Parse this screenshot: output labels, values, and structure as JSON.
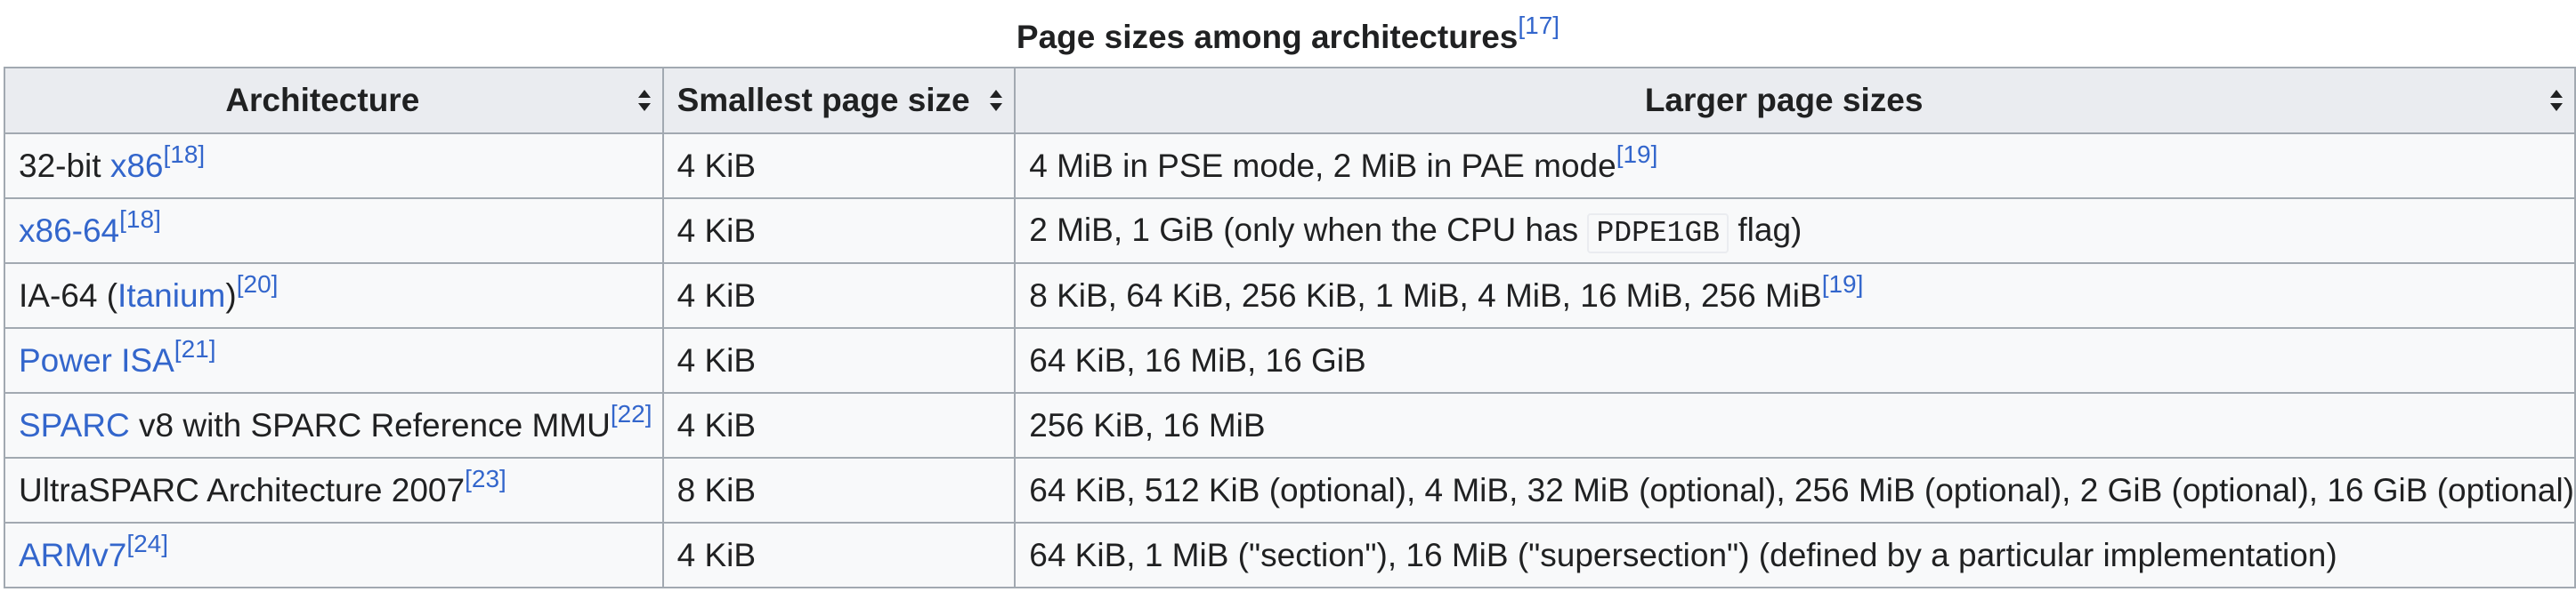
{
  "caption": {
    "text": "Page sizes among architectures",
    "ref": "[17]"
  },
  "headers": [
    {
      "label": "Architecture",
      "sort_icon": "sort-icon"
    },
    {
      "label": "Smallest page size",
      "sort_icon": "sort-icon"
    },
    {
      "label": "Larger page sizes",
      "sort_icon": "sort-icon"
    }
  ],
  "rows": [
    {
      "arch_pre": "32-bit ",
      "arch_link": "x86",
      "arch_post": "",
      "arch_ref": "[18]",
      "smallest": "4 KiB",
      "larger_pre": "4 MiB in PSE mode, 2 MiB in PAE mode",
      "larger_code": "",
      "larger_post": "",
      "larger_ref": "[19]"
    },
    {
      "arch_pre": "",
      "arch_link": "x86-64",
      "arch_post": "",
      "arch_ref": "[18]",
      "smallest": "4 KiB",
      "larger_pre": "2 MiB, 1 GiB (only when the CPU has ",
      "larger_code": "PDPE1GB",
      "larger_post": " flag)",
      "larger_ref": ""
    },
    {
      "arch_pre": "IA-64 (",
      "arch_link": "Itanium",
      "arch_post": ")",
      "arch_ref": "[20]",
      "smallest": "4 KiB",
      "larger_pre": "8 KiB, 64 KiB, 256 KiB, 1 MiB, 4 MiB, 16 MiB, 256 MiB",
      "larger_code": "",
      "larger_post": "",
      "larger_ref": "[19]"
    },
    {
      "arch_pre": "",
      "arch_link": "Power ISA",
      "arch_post": "",
      "arch_ref": "[21]",
      "smallest": "4 KiB",
      "larger_pre": "64 KiB, 16 MiB, 16 GiB",
      "larger_code": "",
      "larger_post": "",
      "larger_ref": ""
    },
    {
      "arch_pre": "",
      "arch_link": "SPARC",
      "arch_post": " v8 with SPARC Reference MMU",
      "arch_ref": "[22]",
      "smallest": "4 KiB",
      "larger_pre": "256 KiB, 16 MiB",
      "larger_code": "",
      "larger_post": "",
      "larger_ref": ""
    },
    {
      "arch_pre": "UltraSPARC Architecture 2007",
      "arch_link": "",
      "arch_post": "",
      "arch_ref": "[23]",
      "smallest": "8 KiB",
      "larger_pre": "64 KiB, 512 KiB (optional), 4 MiB, 32 MiB (optional), 256 MiB (optional), 2 GiB (optional), 16 GiB (optional)",
      "larger_code": "",
      "larger_post": "",
      "larger_ref": ""
    },
    {
      "arch_pre": "",
      "arch_link": "ARMv7",
      "arch_post": "",
      "arch_ref": "[24]",
      "smallest": "4 KiB",
      "larger_pre": "64 KiB, 1 MiB (\"section\"), 16 MiB (\"supersection\") (defined by a particular implementation)",
      "larger_code": "",
      "larger_post": "",
      "larger_ref": ""
    }
  ],
  "colors": {
    "link": "#3366cc",
    "header_bg": "#eaecf0",
    "cell_bg": "#f8f9fa",
    "border": "#a2a9b1"
  }
}
